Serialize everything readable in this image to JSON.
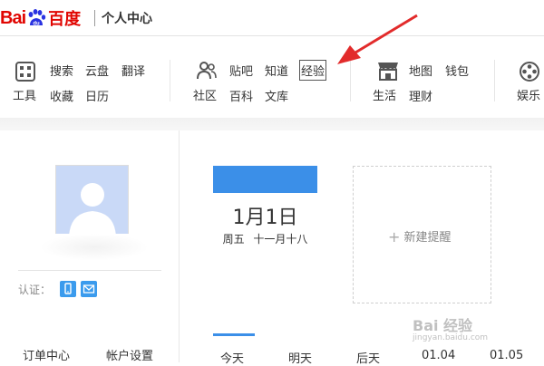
{
  "header": {
    "logo_bai": "Bai",
    "logo_du_mark": "du",
    "logo_cn": "百度",
    "page_title": "个人中心"
  },
  "nav": {
    "tools_label": "工具",
    "tools_links": [
      "搜索",
      "云盘",
      "翻译",
      "收藏",
      "日历"
    ],
    "community_label": "社区",
    "community_links": [
      "贴吧",
      "知道",
      "经验",
      "百科",
      "文库"
    ],
    "life_label": "生活",
    "life_links": [
      "地图",
      "钱包",
      "理财"
    ],
    "ent_label": "娱乐"
  },
  "profile": {
    "auth_label": "认证：",
    "bottom_links": [
      "订单中心",
      "帐户设置"
    ]
  },
  "calendar": {
    "date": "1月1日",
    "weekday": "周五",
    "lunar": "十一月十八",
    "new_reminder": "新建提醒",
    "tabs": [
      "今天",
      "明天",
      "后天",
      "01.04",
      "01.05"
    ]
  },
  "watermark": {
    "main": "Bai 经验",
    "sub": "jingyan.baidu.com"
  },
  "colors": {
    "brand_red": "#e10602",
    "accent_blue": "#3b8fe8",
    "arrow_red": "#e22b2b"
  }
}
